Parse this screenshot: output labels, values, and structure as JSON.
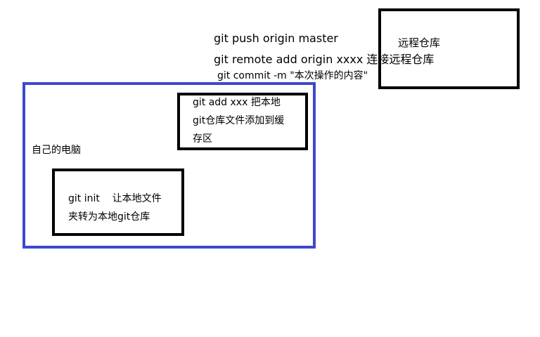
{
  "colors": {
    "computer_border": "#3f48cc",
    "box_border": "#000000",
    "text": "#000000",
    "background": "#ffffff"
  },
  "remote_repo": {
    "label": "远程仓库"
  },
  "commands": {
    "push": "git push origin master",
    "remote_add": "git remote add origin xxxx 连接远程仓库",
    "commit": "git commit -m \"本次操作的内容\""
  },
  "computer": {
    "label": "自己的电脑"
  },
  "git_add_box": {
    "line1": "git add xxx 把本地",
    "line2": "git仓库文件添加到缓",
    "line3": "存区"
  },
  "git_init_box": {
    "line1": "git init    让本地文件",
    "line2": "夹转为本地git仓库"
  }
}
